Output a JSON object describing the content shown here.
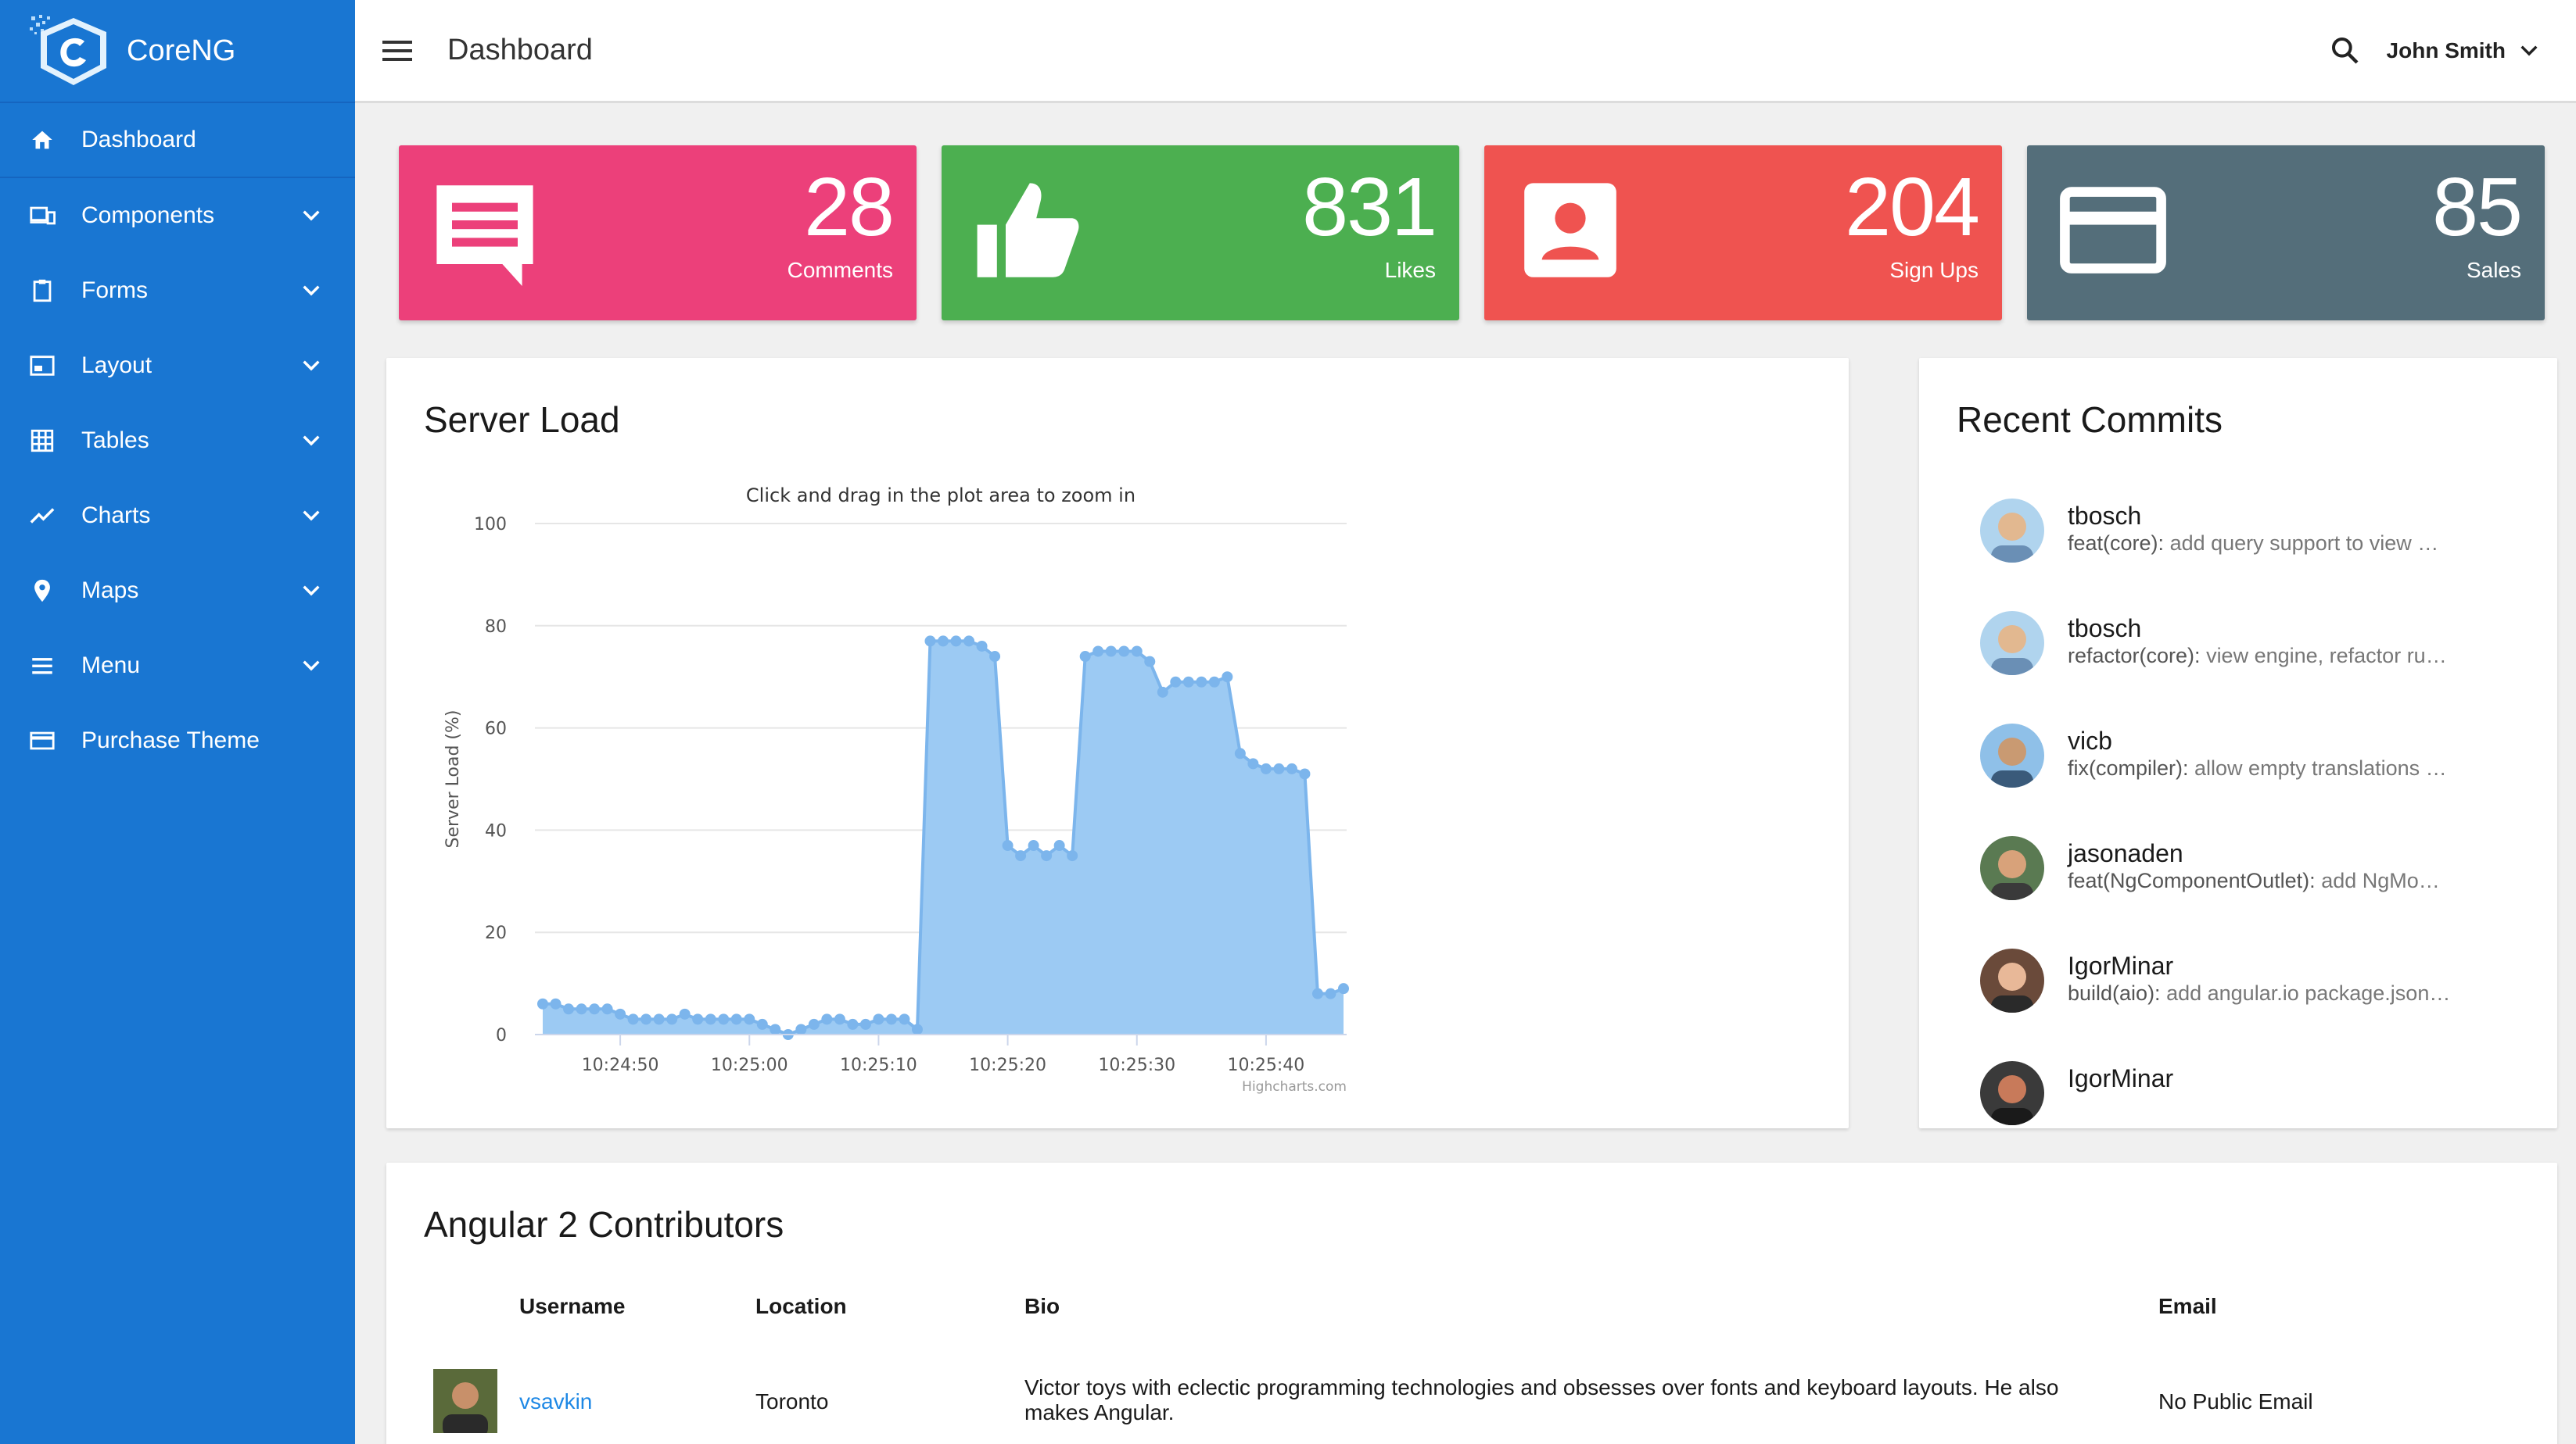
{
  "app": {
    "name": "CoreNG"
  },
  "sidebar": {
    "items": [
      {
        "label": "Dashboard",
        "icon": "home-icon",
        "expandable": false
      },
      {
        "label": "Components",
        "icon": "devices-icon",
        "expandable": true
      },
      {
        "label": "Forms",
        "icon": "clipboard-icon",
        "expandable": true
      },
      {
        "label": "Layout",
        "icon": "picture-in-picture-icon",
        "expandable": true
      },
      {
        "label": "Tables",
        "icon": "grid-icon",
        "expandable": true
      },
      {
        "label": "Charts",
        "icon": "trending-up-icon",
        "expandable": true
      },
      {
        "label": "Maps",
        "icon": "map-pin-icon",
        "expandable": true
      },
      {
        "label": "Menu",
        "icon": "menu-icon",
        "expandable": true
      },
      {
        "label": "Purchase Theme",
        "icon": "credit-card-icon",
        "expandable": false
      }
    ]
  },
  "topbar": {
    "title": "Dashboard",
    "user": "John Smith"
  },
  "stats": [
    {
      "value": "28",
      "label": "Comments",
      "color": "#ec407a",
      "icon": "comment-icon"
    },
    {
      "value": "831",
      "label": "Likes",
      "color": "#4caf50",
      "icon": "thumb-up-icon"
    },
    {
      "value": "204",
      "label": "Sign Ups",
      "color": "#ef5350",
      "icon": "account-box-icon"
    },
    {
      "value": "85",
      "label": "Sales",
      "color": "#546e7a",
      "icon": "credit-card-icon"
    }
  ],
  "server_load": {
    "title": "Server Load",
    "subtitle": "Click and drag in the plot area to zoom in",
    "credit": "Highcharts.com"
  },
  "chart_data": {
    "type": "area",
    "ylabel": "Server Load (%)",
    "ylim": [
      0,
      100
    ],
    "yticks": [
      0,
      20,
      40,
      60,
      80,
      100
    ],
    "xticks": [
      "10:24:50",
      "10:25:00",
      "10:25:10",
      "10:25:20",
      "10:25:30",
      "10:25:40"
    ],
    "x_start_seconds": 44,
    "x_step_seconds": 1,
    "grid": true,
    "legend": "none",
    "color": "#7cb5ec",
    "values": [
      6,
      6,
      5,
      5,
      5,
      5,
      4,
      3,
      3,
      3,
      3,
      4,
      3,
      3,
      3,
      3,
      3,
      2,
      1,
      0,
      1,
      2,
      3,
      3,
      2,
      2,
      3,
      3,
      3,
      1,
      77,
      77,
      77,
      77,
      76,
      74,
      37,
      35,
      37,
      35,
      37,
      35,
      74,
      75,
      75,
      75,
      75,
      73,
      67,
      69,
      69,
      69,
      69,
      70,
      55,
      53,
      52,
      52,
      52,
      51,
      8,
      8,
      9
    ]
  },
  "commits": {
    "title": "Recent Commits",
    "items": [
      {
        "author": "tbosch",
        "type": "feat(core):",
        "msg": "add query support to view …"
      },
      {
        "author": "tbosch",
        "type": "refactor(core):",
        "msg": "view engine, refactor ru…"
      },
      {
        "author": "vicb",
        "type": "fix(compiler):",
        "msg": "allow empty translations …"
      },
      {
        "author": "jasonaden",
        "type": "feat(NgComponentOutlet):",
        "msg": "add NgMo…"
      },
      {
        "author": "IgorMinar",
        "type": "build(aio):",
        "msg": "add angular.io package.json…"
      },
      {
        "author": "IgorMinar",
        "type": "",
        "msg": ""
      }
    ]
  },
  "contributors": {
    "title": "Angular 2 Contributors",
    "headers": [
      "Username",
      "Location",
      "Bio",
      "Email"
    ],
    "rows": [
      {
        "username": "vsavkin",
        "location": "Toronto",
        "bio": "Victor toys with eclectic programming technologies and obsesses over fonts and keyboard layouts. He also makes Angular.",
        "email": "No Public Email"
      }
    ]
  }
}
